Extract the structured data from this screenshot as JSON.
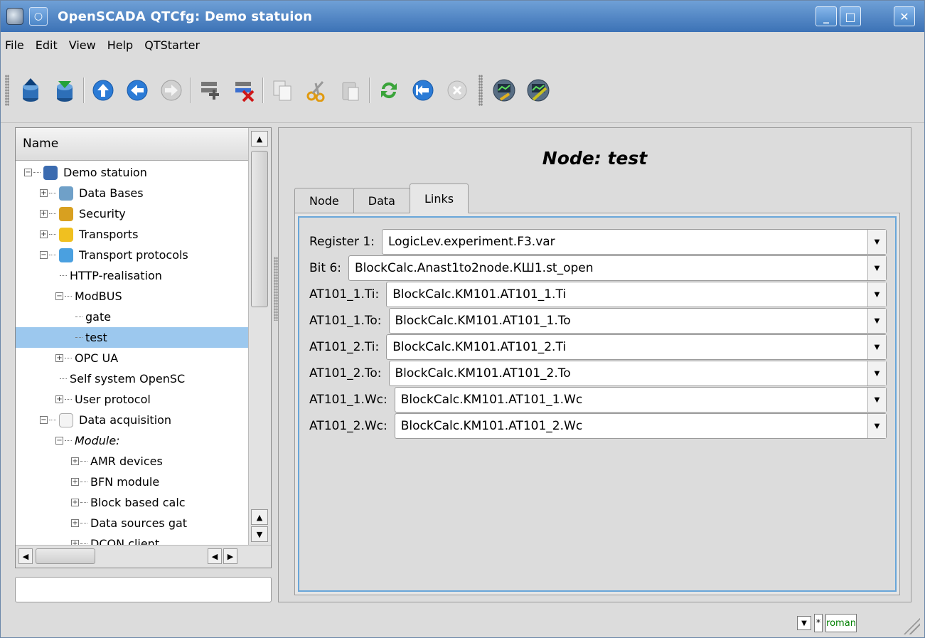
{
  "window": {
    "title": "OpenSCADA QTCfg: Demo statuion"
  },
  "menu": [
    "File",
    "Edit",
    "View",
    "Help",
    "QTStarter"
  ],
  "tree": {
    "header": "Name",
    "items": [
      {
        "label": "Demo statuion",
        "level": 0,
        "expander": "minus",
        "icon": "station"
      },
      {
        "label": "Data Bases",
        "level": 1,
        "expander": "plus",
        "icon": "db"
      },
      {
        "label": "Security",
        "level": 1,
        "expander": "plus",
        "icon": "security"
      },
      {
        "label": "Transports",
        "level": 1,
        "expander": "plus",
        "icon": "transport"
      },
      {
        "label": "Transport protocols",
        "level": 1,
        "expander": "minus",
        "icon": "folder"
      },
      {
        "label": "HTTP-realisation",
        "level": 2,
        "expander": "none"
      },
      {
        "label": "ModBUS",
        "level": 2,
        "expander": "minus"
      },
      {
        "label": "gate",
        "level": 3,
        "expander": "none"
      },
      {
        "label": "test",
        "level": 3,
        "expander": "none",
        "selected": true
      },
      {
        "label": "OPC UA",
        "level": 2,
        "expander": "plus"
      },
      {
        "label": "Self system OpenSC",
        "level": 2,
        "expander": "none"
      },
      {
        "label": "User protocol",
        "level": 2,
        "expander": "plus"
      },
      {
        "label": "Data acquisition",
        "level": 1,
        "expander": "minus",
        "icon": "daq"
      },
      {
        "label": "Module:",
        "level": 2,
        "expander": "minus",
        "italic": true
      },
      {
        "label": "AMR devices",
        "level": 3,
        "expander": "plus"
      },
      {
        "label": "BFN module",
        "level": 3,
        "expander": "plus"
      },
      {
        "label": "Block based calc",
        "level": 3,
        "expander": "plus"
      },
      {
        "label": "Data sources gat",
        "level": 3,
        "expander": "plus"
      },
      {
        "label": "DCON client",
        "level": 3,
        "expander": "plus"
      }
    ]
  },
  "main": {
    "title": "Node: test",
    "tabs": [
      "Node",
      "Data",
      "Links"
    ],
    "active_tab": "Links",
    "links": [
      {
        "label": "Register 1:",
        "value": "LogicLev.experiment.F3.var"
      },
      {
        "label": "Bit 6:",
        "value": "BlockCalc.Anast1to2node.КШ1.st_open"
      },
      {
        "label": "AT101_1.Ti:",
        "value": "BlockCalc.KM101.AT101_1.Ti"
      },
      {
        "label": "AT101_1.To:",
        "value": "BlockCalc.KM101.AT101_1.To"
      },
      {
        "label": "AT101_2.Ti:",
        "value": "BlockCalc.KM101.AT101_2.Ti"
      },
      {
        "label": "AT101_2.To:",
        "value": "BlockCalc.KM101.AT101_2.To"
      },
      {
        "label": "AT101_1.Wc:",
        "value": "BlockCalc.KM101.AT101_1.Wc"
      },
      {
        "label": "AT101_2.Wc:",
        "value": "BlockCalc.KM101.AT101_2.Wc"
      }
    ]
  },
  "statusbar": {
    "modified": "*",
    "user": "roman"
  },
  "colors": {
    "title_bar": "#4a82c4",
    "selection": "#9cc8ee",
    "focus_frame": "#69a6d9",
    "user_text": "#008000"
  }
}
